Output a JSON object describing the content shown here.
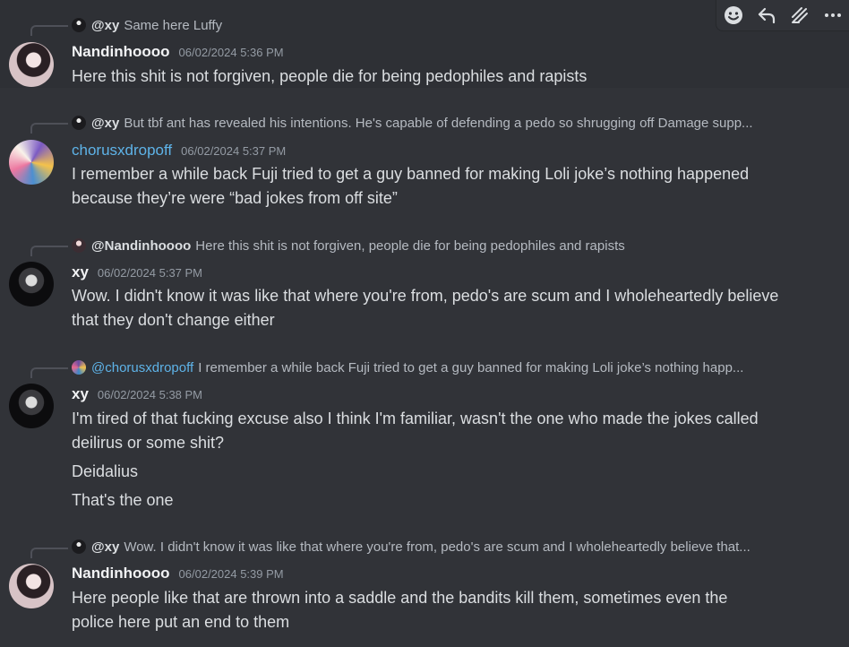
{
  "messages": [
    {
      "reply_user": "@xy",
      "reply_text": "Same here Luffy",
      "username": "Nandinhoooo",
      "timestamp": "06/02/2024 5:36 PM",
      "lines": [
        "Here this shit is not forgiven, people die for being pedophiles and rapists"
      ]
    },
    {
      "reply_user": "@xy",
      "reply_text": "But tbf ant has revealed his intentions. He's capable of defending a pedo so shrugging off Damage supp...",
      "username": "chorusxdropoff",
      "timestamp": "06/02/2024 5:37 PM",
      "lines": [
        "I remember a while back Fuji tried to get a guy banned for making Loli joke’s nothing happened",
        "because they’re were “bad jokes from off site”"
      ]
    },
    {
      "reply_user": "@Nandinhoooo",
      "reply_text": "Here this shit is not forgiven, people die for being pedophiles and rapists",
      "username": "xy",
      "timestamp": "06/02/2024 5:37 PM",
      "lines": [
        "Wow. I didn't know it was like that where you're from, pedo's are scum and I wholeheartedly believe",
        "that they don't change either"
      ]
    },
    {
      "reply_user": "@chorusxdropoff",
      "reply_text": "I remember a while back Fuji tried to get a guy banned for making Loli joke’s nothing happ...",
      "username": "xy",
      "timestamp": "06/02/2024 5:38 PM",
      "lines": [
        "I'm tired of that fucking excuse also I think I'm familiar, wasn't the one who made the jokes called",
        "deilirus or some shit?"
      ],
      "followups": [
        "Deidalius",
        "That's the one"
      ]
    },
    {
      "reply_user": "@xy",
      "reply_text": "Wow. I didn't know it was like that where you're from, pedo's are scum and I wholeheartedly believe that...",
      "username": "Nandinhoooo",
      "timestamp": "06/02/2024 5:39 PM",
      "lines": [
        "Here people like that are thrown into a saddle and the bandits kill them, sometimes even the",
        "police here put an end to them"
      ]
    }
  ],
  "toolbar": {
    "icons": [
      "add-reaction-icon",
      "reply-icon",
      "create-thread-icon",
      "more-options-icon"
    ]
  },
  "colors": {
    "background": "#313338",
    "text": "#dbdee1",
    "username_default": "#f2f3f5",
    "username_blue": "#5eb3e8",
    "timestamp": "#949ba4"
  }
}
